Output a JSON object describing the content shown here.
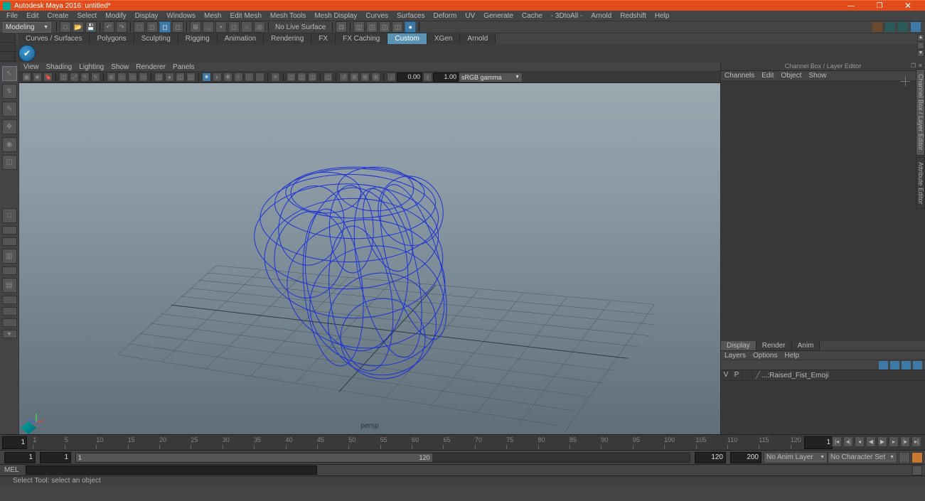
{
  "titlebar": {
    "title": "Autodesk Maya 2016: untitled*"
  },
  "menu": [
    "File",
    "Edit",
    "Create",
    "Select",
    "Modify",
    "Display",
    "Windows",
    "Mesh",
    "Edit Mesh",
    "Mesh Tools",
    "Mesh Display",
    "Curves",
    "Surfaces",
    "Deform",
    "UV",
    "Generate",
    "Cache",
    "- 3DtoAll -",
    "Arnold",
    "Redshift",
    "Help"
  ],
  "workspace_mode": "Modeling",
  "no_live_surface": "No Live Surface",
  "shelf_tabs": [
    "Curves / Surfaces",
    "Polygons",
    "Sculpting",
    "Rigging",
    "Animation",
    "Rendering",
    "FX",
    "FX Caching",
    "Custom",
    "XGen",
    "Arnold"
  ],
  "shelf_active": "Custom",
  "panel_menu": [
    "View",
    "Shading",
    "Lighting",
    "Show",
    "Renderer",
    "Panels"
  ],
  "exposure_value": "0.00",
  "gamma_value": "1.00",
  "color_space": "sRGB gamma",
  "camera_label": "persp",
  "channel_box_title": "Channel Box / Layer Editor",
  "channel_menu": [
    "Channels",
    "Edit",
    "Object",
    "Show"
  ],
  "layer_tabs": [
    "Display",
    "Render",
    "Anim"
  ],
  "layer_tab_active": "Display",
  "layers_menu": [
    "Layers",
    "Options",
    "Help"
  ],
  "layer_row": {
    "v": "V",
    "p": "P",
    "name": "...:Raised_Fist_Emoji"
  },
  "side_tabs": [
    "Channel Box / Layer Editor",
    "Attribute Editor"
  ],
  "timeline": {
    "current_frame_left": "1",
    "current_frame_right": "1",
    "ticks": [
      "1",
      "5",
      "10",
      "15",
      "20",
      "25",
      "30",
      "35",
      "40",
      "45",
      "50",
      "55",
      "60",
      "65",
      "70",
      "75",
      "80",
      "85",
      "90",
      "95",
      "100",
      "105",
      "110",
      "115",
      "120"
    ],
    "range_start_outer": "1",
    "range_start_inner": "1",
    "range_inner_start": "1",
    "range_inner_end": "120",
    "range_end_inner": "120",
    "range_end_outer": "200",
    "anim_layer": "No Anim Layer",
    "char_set": "No Character Set"
  },
  "mel_label": "MEL",
  "help_line": "Select Tool: select an object"
}
